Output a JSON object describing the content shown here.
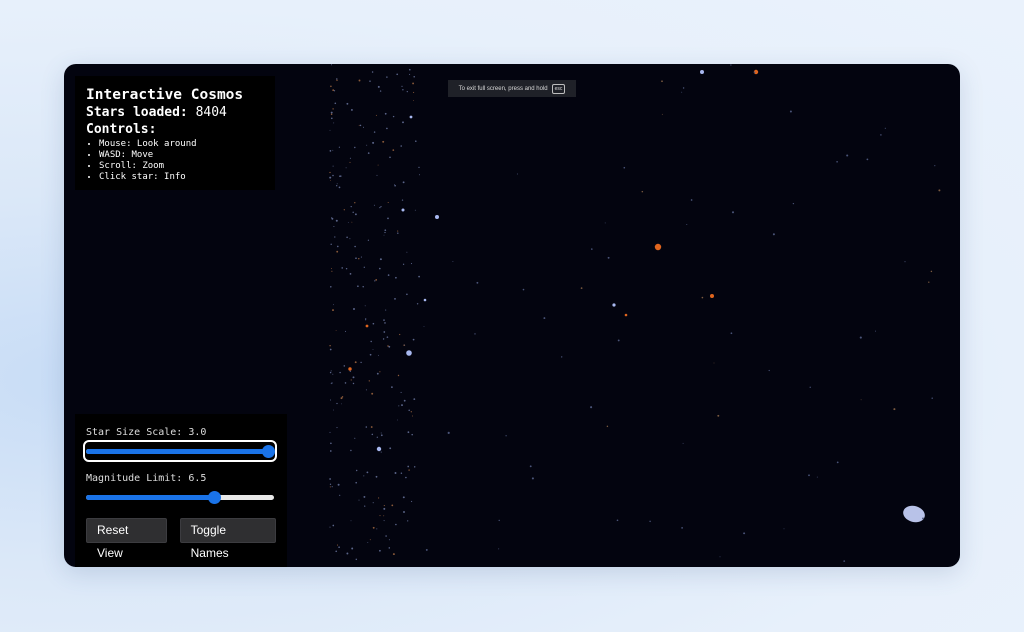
{
  "fullscreen_notice": {
    "text": "To exit full screen, press and hold",
    "key": "esc"
  },
  "info": {
    "title": "Interactive Cosmos",
    "stars_label": "Stars loaded:",
    "stars_count": "8404",
    "controls_heading": "Controls:",
    "controls": [
      "Mouse: Look around",
      "WASD: Move",
      "Scroll: Zoom",
      "Click star: Info"
    ]
  },
  "controls_panel": {
    "star_size": {
      "label": "Star Size Scale: 3.0",
      "fraction": 1.0
    },
    "magnitude": {
      "label": "Magnitude Limit: 6.5",
      "fraction": 0.68
    },
    "reset_label": "Reset View",
    "toggle_label": "Toggle Names"
  },
  "colors": {
    "background": "#03040f",
    "accent": "#1a73e8",
    "star_blue": "#a8b8f0",
    "star_orange": "#e0651e"
  }
}
